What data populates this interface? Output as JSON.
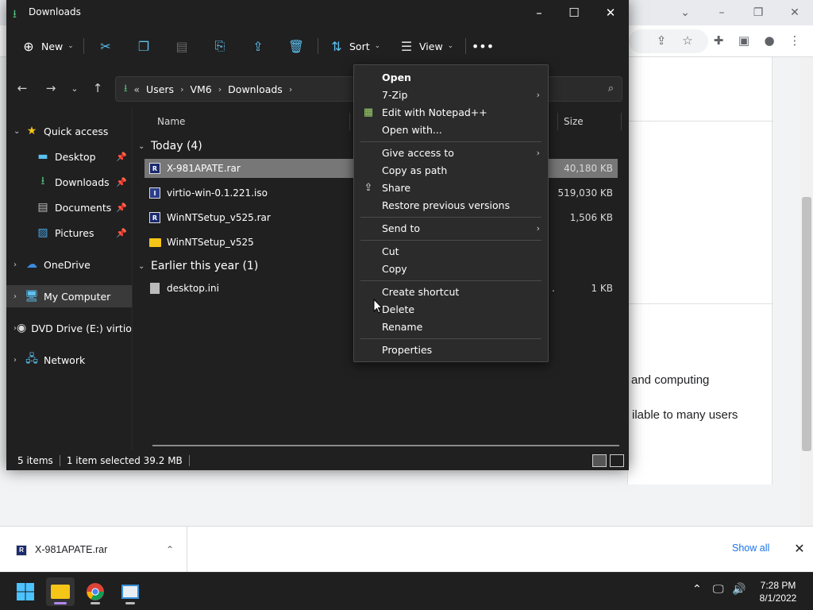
{
  "browser": {
    "page_text_1": "and computing",
    "page_text_2": "ilable to many users"
  },
  "explorer": {
    "title": "Downloads",
    "toolbar": {
      "new_label": "New",
      "sort_label": "Sort",
      "view_label": "View"
    },
    "breadcrumb": [
      "Users",
      "VM6",
      "Downloads"
    ],
    "breadcrumb_prefix": "«",
    "nav": {
      "quick_access": "Quick access",
      "desktop": "Desktop",
      "downloads": "Downloads",
      "documents": "Documents",
      "pictures": "Pictures",
      "onedrive": "OneDrive",
      "my_computer": "My Computer",
      "dvd_drive": "DVD Drive (E:) virtio-",
      "network": "Network"
    },
    "columns": {
      "name": "Name",
      "size": "Size"
    },
    "groups": {
      "today": "Today (4)",
      "earlier": "Earlier this year (1)"
    },
    "files": [
      {
        "name": "X-981APATE.rar",
        "size": "40,180 KB"
      },
      {
        "name": "virtio-win-0.1.221.iso",
        "size": "519,030 KB"
      },
      {
        "name": "WinNTSetup_v525.rar",
        "size": "1,506 KB"
      },
      {
        "name": "WinNTSetup_v525",
        "size": ""
      },
      {
        "name": "desktop.ini",
        "size": "1 KB"
      }
    ],
    "desktop_ini_trail": ".",
    "status": {
      "items": "5 items",
      "selected": "1 item selected  39.2 MB"
    }
  },
  "context_menu": {
    "open": "Open",
    "seven_zip": "7-Zip",
    "edit_notepad": "Edit with Notepad++",
    "open_with": "Open with...",
    "give_access": "Give access to",
    "copy_as_path": "Copy as path",
    "share": "Share",
    "restore": "Restore previous versions",
    "send_to": "Send to",
    "cut": "Cut",
    "copy": "Copy",
    "create_shortcut": "Create shortcut",
    "delete": "Delete",
    "rename": "Rename",
    "properties": "Properties"
  },
  "download_bar": {
    "file_name": "X-981APATE.rar",
    "show_all": "Show all"
  },
  "taskbar": {
    "time": "7:28 PM",
    "date": "8/1/2022"
  },
  "colors": {
    "explorer_bg": "#202020",
    "menu_bg": "#2b2b2b",
    "selection": "#777777",
    "accent_blue": "#1a73e8"
  }
}
